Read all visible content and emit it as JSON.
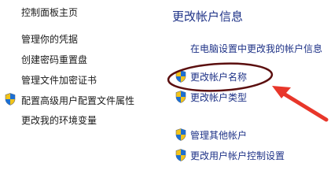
{
  "sidebar": {
    "items": [
      {
        "label": "控制面板主页",
        "shield": false
      },
      {
        "label": "管理你的凭据",
        "shield": false
      },
      {
        "label": "创建密码重置盘",
        "shield": false
      },
      {
        "label": "管理文件加密证书",
        "shield": false
      },
      {
        "label": "配置高级用户配置文件属性",
        "shield": true
      },
      {
        "label": "更改我的环境变量",
        "shield": false
      }
    ]
  },
  "main": {
    "title": "更改帐户信息",
    "links": [
      {
        "label": "在电脑设置中更改我的帐户信息",
        "shield": false
      },
      {
        "label": "更改帐户名称",
        "shield": true,
        "highlighted": true
      },
      {
        "label": "更改帐户类型",
        "shield": true
      },
      {
        "label": "管理其他帐户",
        "shield": true
      },
      {
        "label": "更改用户帐户控制设置",
        "shield": true
      }
    ]
  },
  "annotation": {
    "circle_color": "#5b0f0f",
    "arrow_color": "#e8362a"
  },
  "colors": {
    "link": "#1e3287",
    "shield_blue": "#1d6fd1",
    "shield_yellow": "#f2c419"
  }
}
